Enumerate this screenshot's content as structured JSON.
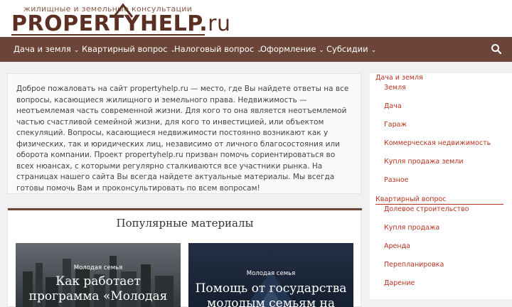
{
  "header": {
    "tagline": "жилищные и земельные консультации",
    "logo_left": "PROPERT",
    "logo_y": "Y",
    "logo_right": "HELP.",
    "logo_ru": "ru"
  },
  "nav": {
    "items": [
      {
        "label": "Дача и земля"
      },
      {
        "label": "Квартирный вопрос"
      },
      {
        "label": "Налоговый вопрос"
      },
      {
        "label": "Оформление"
      },
      {
        "label": "Субсидии"
      }
    ],
    "search_icon": "search-icon"
  },
  "intro": {
    "text": "Доброе пожаловать на сайт propertyhelp.ru — место, где Вы найдете ответы на все вопросы, касающиеся жилищного и земельного права. Недвижимость — неотъемлемая часть современной жизни. Для кого то она является неотъемлемой частью счастливой семейной жизни, для кого то инвестицией, или объектом спекуляций. Вопросы, касающиеся недвижимости постоянно возникают как у физических, так и юридических лиц, независимо от личного благосостояния или оборота компании. Проект propertyhelp.ru призван помочь сориентироваться во всех нюансах, с которыми регулярно сталкиваются все участники рынка. На страницах нашего сайта Вы всегда найдете актуальные материалы. Мы всегда готовы помочь Вам и проконсультировать по всем вопросам!"
  },
  "popular": {
    "title": "Популярные материалы",
    "cards": [
      {
        "badge": "Молодая семья",
        "title_line1": "Как работает",
        "title_line2": "программа «Молодая"
      },
      {
        "badge": "Молодая семья",
        "title_line1": "Помощь от государства",
        "title_line2": "молодым семьям на"
      }
    ]
  },
  "sidebar": {
    "sections": [
      {
        "title": "Дача и земля",
        "items": [
          "Земля",
          "Дача",
          "Гараж",
          "Коммерческая недвижимость",
          "Купля продажа земли",
          "Разное"
        ]
      },
      {
        "title": "Квартирный вопрос",
        "items": [
          "Долевое строительство",
          "Купля продажа",
          "Аренда",
          "Перепланировка",
          "Дарение"
        ]
      }
    ]
  },
  "colors": {
    "brand_brown": "#6b4537",
    "logo_dark": "#5b2f22",
    "sidebar_link": "#b8321f"
  }
}
